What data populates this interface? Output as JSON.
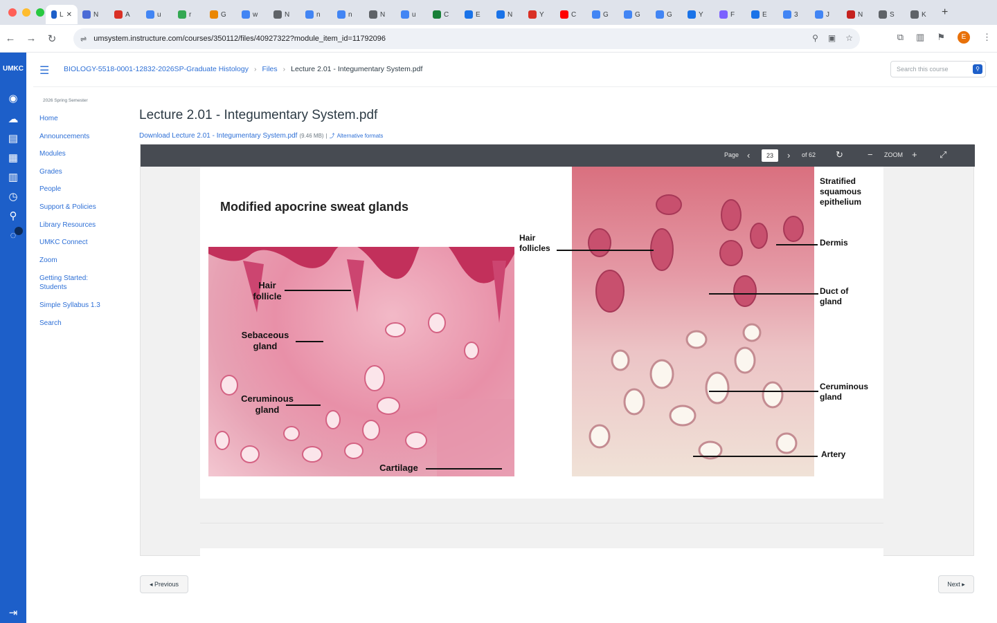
{
  "browser": {
    "active_tab_title": "L",
    "tabs": [
      "N",
      "A",
      "u",
      "r",
      "G",
      "w",
      "N",
      "n",
      "n",
      "N",
      "u",
      "C",
      "E",
      "N",
      "Y",
      "C",
      "G",
      "G",
      "G",
      "Y",
      "F",
      "E",
      "3",
      "J",
      "N",
      "S",
      "K"
    ],
    "url": "umsystem.instructure.com/courses/350112/files/40927322?module_item_id=11792096"
  },
  "colors": {
    "canvas_nav": "#1d5fc9",
    "link": "#2d6fd6",
    "viewer_bar": "#474b52"
  },
  "breadcrumb": {
    "course": "BIOLOGY-5518-0001-12832-2026SP-Graduate Histology",
    "files": "Files",
    "current": "Lecture 2.01 - Integumentary System.pdf"
  },
  "search": {
    "placeholder": "Search this course"
  },
  "course_nav": {
    "term": "2026 Spring Semester",
    "items": [
      "Home",
      "Announcements",
      "Modules",
      "Grades",
      "People",
      "Support & Policies",
      "Library Resources",
      "UMKC Connect",
      "Zoom",
      "Getting Started: Students",
      "Simple Syllabus 1.3",
      "Search"
    ]
  },
  "file": {
    "title": "Lecture 2.01 - Integumentary System.pdf",
    "download_label": "Download Lecture 2.01 - Integumentary System.pdf",
    "size": "(9.46 MB)",
    "alt_formats": "Alternative formats"
  },
  "viewer": {
    "page_label": "Page",
    "page_number": "23",
    "of_label": "of 62",
    "zoom": "ZOOM"
  },
  "slide": {
    "title": "Modified apocrine sweat glands",
    "left_labels": [
      "Hair follicle",
      "Sebaceous gland",
      "Ceruminous gland",
      "Cartilage"
    ],
    "right_labels": [
      "Hair follicles",
      "Stratified squamous epithelium",
      "Dermis",
      "Duct of gland",
      "Ceruminous gland",
      "Artery"
    ]
  },
  "footer": {
    "prev": "◂ Previous",
    "next": "Next ▸"
  }
}
